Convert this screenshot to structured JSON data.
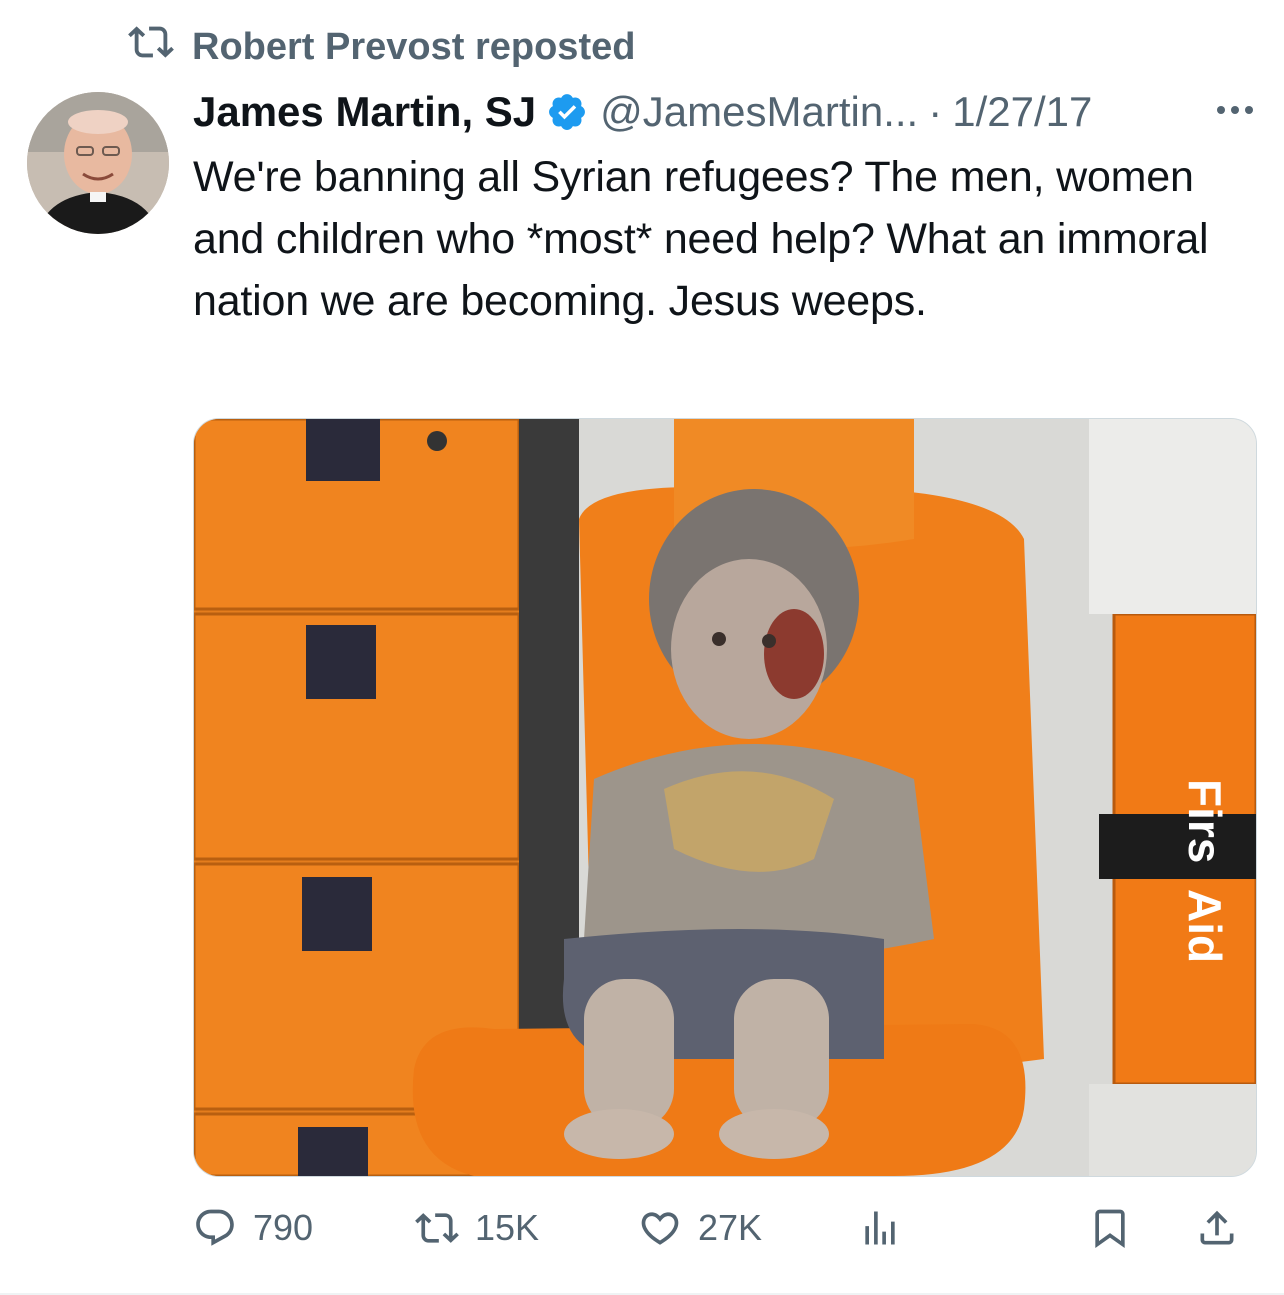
{
  "repost": {
    "icon": "repost-icon",
    "text": "Robert Prevost reposted"
  },
  "tweet": {
    "avatar": "avatar-image",
    "author_name": "James Martin, SJ",
    "verified_icon": "verified-badge-icon",
    "handle": "@JamesMartin...",
    "separator": "·",
    "date": "1/27/17",
    "more_icon": "more-icon",
    "text": "We're banning all Syrian refugees? The men, women and children who *most* need help? What an immoral nation we are becoming. Jesus weeps.",
    "media": {
      "description_icon": "photo-image",
      "sign_text_top": "Firs",
      "sign_text_bottom": "Aid"
    }
  },
  "actions": {
    "replies": "790",
    "reposts": "15K",
    "likes": "27K"
  },
  "colors": {
    "text": "#0f1419",
    "secondary": "#536471",
    "verified": "#1d9bf0",
    "orange": "#f07f1a"
  }
}
